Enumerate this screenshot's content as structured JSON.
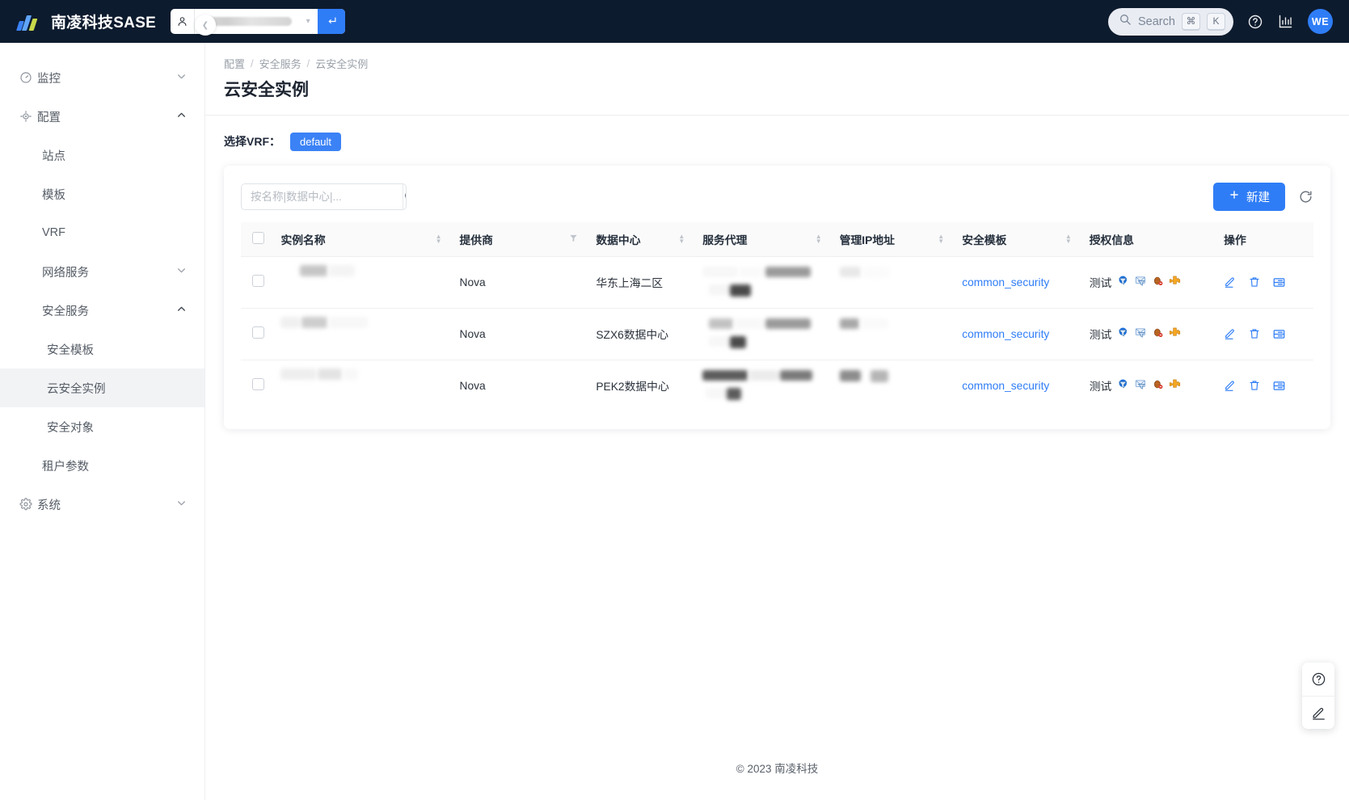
{
  "header": {
    "brand": "南凌科技SASE",
    "logo_icon": "logo-bars-icon",
    "tenant": {
      "user_icon": "user-icon",
      "value": "",
      "caret_icon": "chevron-down-icon",
      "go_icon": "enter-arrow-icon"
    },
    "search": {
      "icon": "search-icon",
      "label": "Search",
      "key_meta": "⌘",
      "key_letter": "K"
    },
    "help_icon": "question-circle-icon",
    "stats_icon": "bar-chart-icon",
    "avatar": "WE",
    "accent": "#2f7df6",
    "bg": "#0d1b2e"
  },
  "sidebar": {
    "collapse_icon": "chevron-left-icon",
    "items": [
      {
        "label": "监控",
        "icon": "gauge-icon",
        "level": 1,
        "caret": "chevron-down-icon",
        "active": false
      },
      {
        "label": "配置",
        "icon": "target-icon",
        "level": 1,
        "caret": "chevron-up-icon",
        "active": false
      },
      {
        "label": "站点",
        "icon": "",
        "level": 2,
        "caret": "",
        "active": false
      },
      {
        "label": "模板",
        "icon": "",
        "level": 2,
        "caret": "",
        "active": false
      },
      {
        "label": "VRF",
        "icon": "",
        "level": 2,
        "caret": "",
        "active": false
      },
      {
        "label": "网络服务",
        "icon": "",
        "level": 2,
        "caret": "chevron-down-icon",
        "active": false
      },
      {
        "label": "安全服务",
        "icon": "",
        "level": 2,
        "caret": "chevron-up-icon",
        "active": false
      },
      {
        "label": "安全模板",
        "icon": "",
        "level": 3,
        "caret": "",
        "active": false
      },
      {
        "label": "云安全实例",
        "icon": "",
        "level": 3,
        "caret": "",
        "active": true
      },
      {
        "label": "安全对象",
        "icon": "",
        "level": 3,
        "caret": "",
        "active": false
      },
      {
        "label": "租户参数",
        "icon": "",
        "level": 2,
        "caret": "",
        "active": false
      },
      {
        "label": "系统",
        "icon": "gear-icon",
        "level": 1,
        "caret": "chevron-down-icon",
        "active": false
      }
    ]
  },
  "breadcrumb": {
    "items": [
      "配置",
      "安全服务",
      "云安全实例"
    ],
    "separator": "/"
  },
  "page": {
    "title": "云安全实例"
  },
  "vrf": {
    "label": "选择VRF：",
    "selected": "default"
  },
  "toolbar": {
    "search_placeholder": "按名称|数据中心|...",
    "search_value": "",
    "search_icon": "search-icon",
    "new_label": "新建",
    "new_icon": "plus-icon",
    "refresh_icon": "refresh-icon"
  },
  "table": {
    "select_all_icon": "checkbox-icon",
    "columns": [
      {
        "label": "实例名称",
        "tool": "sort"
      },
      {
        "label": "提供商",
        "tool": "filter"
      },
      {
        "label": "数据中心",
        "tool": "sort"
      },
      {
        "label": "服务代理",
        "tool": "sort"
      },
      {
        "label": "管理IP地址",
        "tool": "sort"
      },
      {
        "label": "安全模板",
        "tool": "sort"
      },
      {
        "label": "授权信息",
        "tool": "none"
      },
      {
        "label": "操作",
        "tool": "none"
      }
    ],
    "rows": [
      {
        "name": "",
        "provider": "Nova",
        "datacenter": "华东上海二区",
        "proxy": "",
        "mgmt_ip": "",
        "security_template": "common_security",
        "auth_text": "测试",
        "auth_icons": [
          "globe-filter-icon",
          "mail-filter-icon",
          "bug-icon",
          "puzzle-icon"
        ],
        "actions": [
          "edit-icon",
          "delete-icon",
          "detail-list-icon"
        ]
      },
      {
        "name": "",
        "provider": "Nova",
        "datacenter": "SZX6数据中心",
        "proxy": "",
        "mgmt_ip": "",
        "security_template": "common_security",
        "auth_text": "测试",
        "auth_icons": [
          "globe-filter-icon",
          "mail-filter-icon",
          "bug-icon",
          "puzzle-icon"
        ],
        "actions": [
          "edit-icon",
          "delete-icon",
          "detail-list-icon"
        ]
      },
      {
        "name": "",
        "provider": "Nova",
        "datacenter": "PEK2数据中心",
        "proxy": "",
        "mgmt_ip": "",
        "security_template": "common_security",
        "auth_text": "测试",
        "auth_icons": [
          "globe-filter-icon",
          "mail-filter-icon",
          "bug-icon",
          "puzzle-icon"
        ],
        "actions": [
          "edit-icon",
          "delete-icon",
          "detail-list-icon"
        ]
      }
    ]
  },
  "footer": {
    "text": "© 2023 南凌科技"
  },
  "float_panel": {
    "buttons": [
      {
        "icon": "question-circle-icon"
      },
      {
        "icon": "pencil-underline-icon"
      }
    ]
  }
}
